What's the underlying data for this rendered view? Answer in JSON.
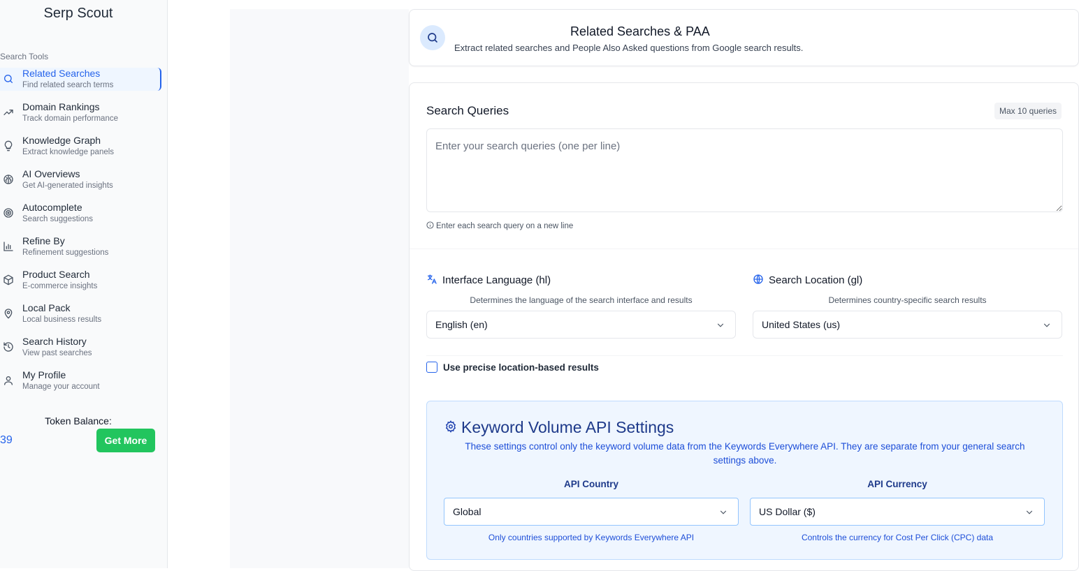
{
  "app": {
    "title": "Serp Scout"
  },
  "sidebar": {
    "section_label": "Search Tools",
    "items": [
      {
        "title": "Related Searches",
        "subtitle": "Find related search terms",
        "icon": "search-icon"
      },
      {
        "title": "Domain Rankings",
        "subtitle": "Track domain performance",
        "icon": "trending-up-icon"
      },
      {
        "title": "Knowledge Graph",
        "subtitle": "Extract knowledge panels",
        "icon": "lightbulb-icon"
      },
      {
        "title": "AI Overviews",
        "subtitle": "Get AI-generated insights",
        "icon": "brain-icon"
      },
      {
        "title": "Autocomplete",
        "subtitle": "Search suggestions",
        "icon": "target-icon"
      },
      {
        "title": "Refine By",
        "subtitle": "Refinement suggestions",
        "icon": "bar-chart-icon"
      },
      {
        "title": "Product Search",
        "subtitle": "E-commerce insights",
        "icon": "package-icon"
      },
      {
        "title": "Local Pack",
        "subtitle": "Local business results",
        "icon": "map-pin-icon"
      },
      {
        "title": "Search History",
        "subtitle": "View past searches",
        "icon": "history-icon"
      },
      {
        "title": "My Profile",
        "subtitle": "Manage your account",
        "icon": "user-icon"
      }
    ],
    "active_index": 0,
    "token_label": "Token Balance:",
    "token_value": "39",
    "get_more_label": "Get More"
  },
  "header": {
    "title": "Related Searches & PAA",
    "subtitle": "Extract related searches and People Also Asked questions from Google search results.",
    "icon": "search-icon"
  },
  "queries": {
    "title": "Search Queries",
    "badge": "Max 10 queries",
    "placeholder": "Enter your search queries (one per line)",
    "value": "",
    "hint": "Enter each search query on a new line"
  },
  "language": {
    "label": "Interface Language (hl)",
    "description": "Determines the language of the search interface and results",
    "selected": "English (en)",
    "icon": "translate-icon"
  },
  "location": {
    "label": "Search Location (gl)",
    "description": "Determines country-specific search results",
    "selected": "United States (us)",
    "icon": "globe-icon"
  },
  "precise_location": {
    "label": "Use precise location-based results",
    "checked": false
  },
  "keyword_volume": {
    "title": "Keyword Volume API Settings",
    "description": "These settings control only the keyword volume data from the Keywords Everywhere API. They are separate from your general search settings above.",
    "country_label": "API Country",
    "country_selected": "Global",
    "country_note": "Only countries supported by Keywords Everywhere API",
    "currency_label": "API Currency",
    "currency_selected": "US Dollar ($)",
    "currency_note": "Controls the currency for Cost Per Click (CPC) data"
  },
  "colors": {
    "accent": "#2563eb",
    "success": "#22c55e",
    "info_bg": "#eff6ff",
    "info_text": "#1e3a8a"
  }
}
